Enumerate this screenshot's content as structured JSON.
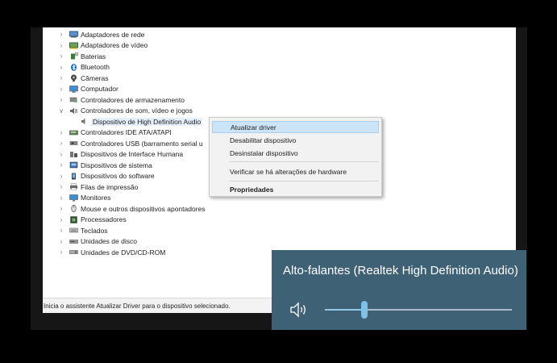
{
  "tree": [
    {
      "label": "Adaptadores de rede",
      "icon": "network-adapter-icon",
      "chevron": "right",
      "level": 0
    },
    {
      "label": "Adaptadores de vídeo",
      "icon": "display-adapter-icon",
      "chevron": "right",
      "level": 0
    },
    {
      "label": "Baterias",
      "icon": "battery-icon",
      "chevron": "right",
      "level": 0
    },
    {
      "label": "Bluetooth",
      "icon": "bluetooth-icon",
      "chevron": "right",
      "level": 0
    },
    {
      "label": "Câmeras",
      "icon": "camera-icon",
      "chevron": "right",
      "level": 0
    },
    {
      "label": "Computador",
      "icon": "computer-icon",
      "chevron": "right",
      "level": 0
    },
    {
      "label": "Controladores de armazenamento",
      "icon": "storage-controller-icon",
      "chevron": "right",
      "level": 0
    },
    {
      "label": "Controladores de som, vídeo e jogos",
      "icon": "sound-controller-icon",
      "chevron": "down",
      "level": 0
    },
    {
      "label": "Dispositivo de High Definition Audio",
      "icon": "audio-device-icon",
      "chevron": "",
      "level": 1,
      "selected": true
    },
    {
      "label": "Controladores IDE ATA/ATAPI",
      "icon": "ide-controller-icon",
      "chevron": "right",
      "level": 0
    },
    {
      "label": "Controladores USB (barramento serial u",
      "icon": "usb-controller-icon",
      "chevron": "right",
      "level": 0
    },
    {
      "label": "Dispositivos de Interface Humana",
      "icon": "hid-icon",
      "chevron": "right",
      "level": 0
    },
    {
      "label": "Dispositivos de sistema",
      "icon": "system-device-icon",
      "chevron": "right",
      "level": 0
    },
    {
      "label": "Dispositivos do software",
      "icon": "software-device-icon",
      "chevron": "right",
      "level": 0
    },
    {
      "label": "Filas de impressão",
      "icon": "print-queue-icon",
      "chevron": "right",
      "level": 0
    },
    {
      "label": "Monitores",
      "icon": "monitor-icon",
      "chevron": "right",
      "level": 0
    },
    {
      "label": "Mouse e outros dispositivos apontadores",
      "icon": "mouse-icon",
      "chevron": "right",
      "level": 0
    },
    {
      "label": "Processadores",
      "icon": "processor-icon",
      "chevron": "right",
      "level": 0
    },
    {
      "label": "Teclados",
      "icon": "keyboard-icon",
      "chevron": "right",
      "level": 0
    },
    {
      "label": "Unidades de disco",
      "icon": "disk-drive-icon",
      "chevron": "right",
      "level": 0
    },
    {
      "label": "Unidades de DVD/CD-ROM",
      "icon": "dvd-drive-icon",
      "chevron": "right",
      "level": 0
    }
  ],
  "context_menu": {
    "items": [
      {
        "label": "Atualizar driver",
        "highlighted": true
      },
      {
        "label": "Desabilitar dispositivo"
      },
      {
        "label": "Desinstalar dispositivo"
      },
      {
        "separator": true
      },
      {
        "label": "Verificar se há alterações de hardware"
      },
      {
        "separator": true
      },
      {
        "label": "Propriedades",
        "bold": true
      }
    ]
  },
  "status_bar": "Inicia o assistente Atualizar Driver para o dispositivo selecionado.",
  "volume_flyout": {
    "device_name": "Alto-falantes (Realtek High Definition Audio)",
    "speaker_icon": "speaker-icon",
    "level_fraction": 0.21
  },
  "colors": {
    "flyout_bg": "#3f6175",
    "slider_accent": "#7fc0e6",
    "menu_highlight": "#cce4f7"
  }
}
